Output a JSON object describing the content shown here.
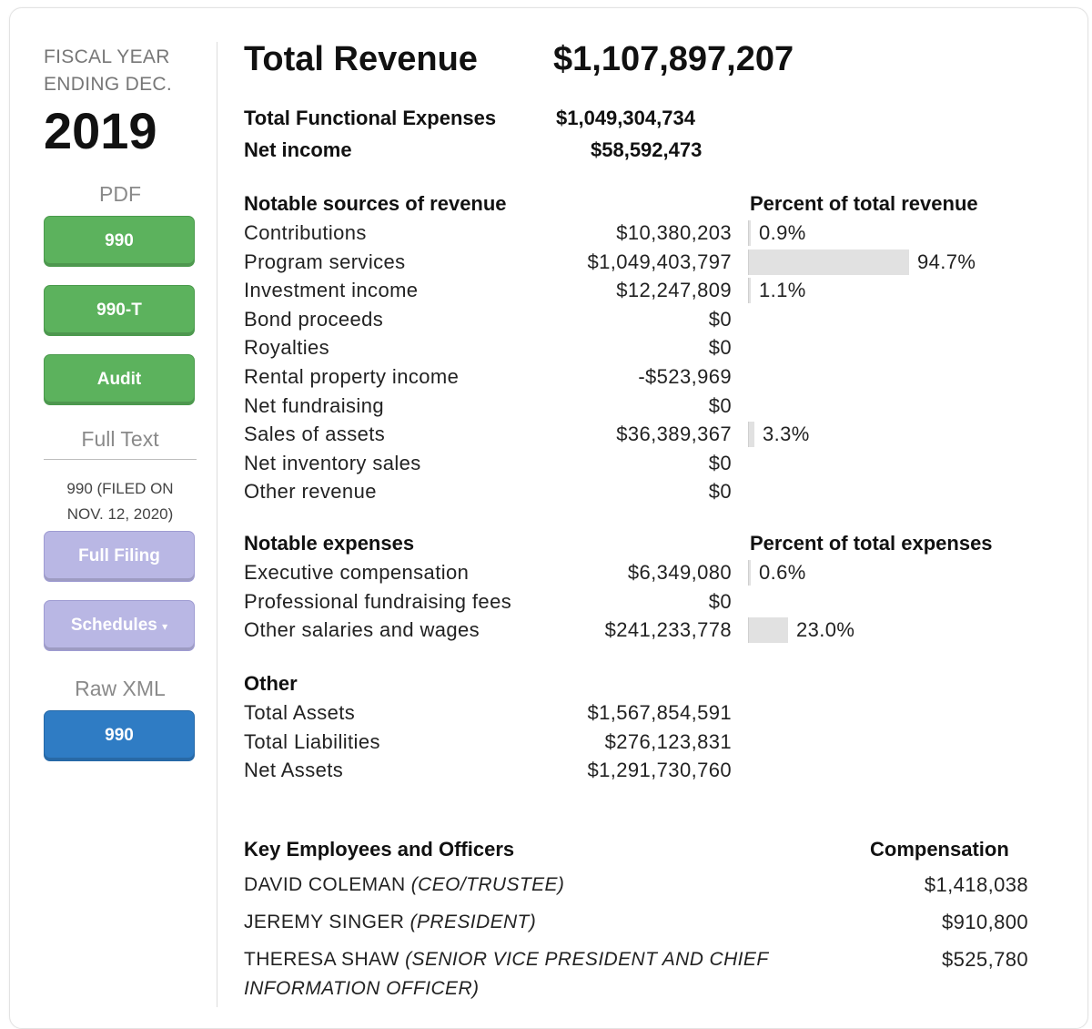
{
  "sidebar": {
    "fiscal_label_1": "FISCAL YEAR",
    "fiscal_label_2": "ENDING DEC.",
    "year": "2019",
    "pdf_label": "PDF",
    "pdf_buttons": [
      "990",
      "990-T",
      "Audit"
    ],
    "full_text_label": "Full Text",
    "filed_line_1": "990 (FILED ON",
    "filed_line_2": "NOV. 12, 2020)",
    "full_filing_label": "Full Filing",
    "schedules_label": "Schedules",
    "schedules_caret": "▾",
    "raw_xml_label": "Raw XML",
    "xml_button": "990"
  },
  "summary": {
    "total_revenue_label": "Total Revenue",
    "total_revenue_value": "$1,107,897,207",
    "expenses_label": "Total Functional Expenses",
    "expenses_value": "$1,049,304,734",
    "net_income_label": "Net income",
    "net_income_value": "$58,592,473"
  },
  "revenue": {
    "heading": "Notable sources of revenue",
    "pct_heading": "Percent of total revenue",
    "rows": [
      {
        "label": "Contributions",
        "value": "$10,380,203",
        "pct": "0.9%",
        "share": 0.009
      },
      {
        "label": "Program services",
        "value": "$1,049,403,797",
        "pct": "94.7%",
        "share": 0.947
      },
      {
        "label": "Investment income",
        "value": "$12,247,809",
        "pct": "1.1%",
        "share": 0.011
      },
      {
        "label": "Bond proceeds",
        "value": "$0"
      },
      {
        "label": "Royalties",
        "value": "$0"
      },
      {
        "label": "Rental property income",
        "value": "-$523,969"
      },
      {
        "label": "Net fundraising",
        "value": "$0"
      },
      {
        "label": "Sales of assets",
        "value": "$36,389,367",
        "pct": "3.3%",
        "share": 0.033
      },
      {
        "label": "Net inventory sales",
        "value": "$0"
      },
      {
        "label": "Other revenue",
        "value": "$0"
      }
    ]
  },
  "expenses": {
    "heading": "Notable expenses",
    "pct_heading": "Percent of total expenses",
    "rows": [
      {
        "label": "Executive compensation",
        "value": "$6,349,080",
        "pct": "0.6%",
        "share": 0.006
      },
      {
        "label": "Professional fundraising fees",
        "value": "$0"
      },
      {
        "label": "Other salaries and wages",
        "value": "$241,233,778",
        "pct": "23.0%",
        "share": 0.23
      }
    ]
  },
  "other": {
    "heading": "Other",
    "rows": [
      {
        "label": "Total Assets",
        "value": "$1,567,854,591"
      },
      {
        "label": "Total Liabilities",
        "value": "$276,123,831",
        "negative": true
      },
      {
        "label": "Net Assets",
        "value": "$1,291,730,760"
      }
    ]
  },
  "employees": {
    "heading": "Key Employees and Officers",
    "comp_heading": "Compensation",
    "rows": [
      {
        "name": "DAVID COLEMAN",
        "title": "(CEO/TRUSTEE)",
        "comp": "$1,418,038"
      },
      {
        "name": "JEREMY SINGER",
        "title": "(PRESIDENT)",
        "comp": "$910,800"
      },
      {
        "name": "THERESA SHAW",
        "title": "(SENIOR VICE PRESIDENT AND CHIEF",
        "title_cont": "INFORMATION OFFICER)",
        "comp": "$525,780"
      }
    ]
  },
  "colors": {
    "negative": "#d42a2a",
    "green_button": "#5cb25d",
    "purple_button": "#b9b7e4",
    "blue_button": "#2f7cc4",
    "bar": "#e1e1e1"
  }
}
